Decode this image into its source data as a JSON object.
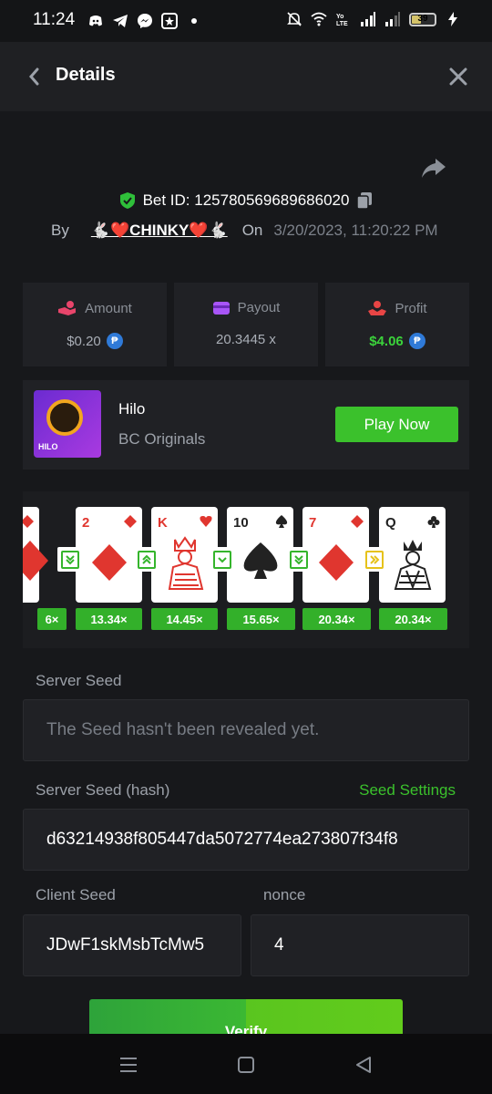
{
  "status_bar": {
    "time": "11:24",
    "battery": "39"
  },
  "header": {
    "title": "Details"
  },
  "bet": {
    "id_label": "Bet ID: 125780569689686020",
    "by_label": "By",
    "user": "🐇❤️CHINKY❤️🐇",
    "on_label": "On",
    "date": "3/20/2023, 11:20:22 PM"
  },
  "stats": [
    {
      "label": "Amount",
      "value": "$0.20",
      "coin": "₱",
      "icon": "hand-coin-icon"
    },
    {
      "label": "Payout",
      "value": "20.3445 x",
      "icon": "card-icon"
    },
    {
      "label": "Profit",
      "value": "$4.06",
      "coin": "₱",
      "icon": "profit-icon"
    }
  ],
  "game": {
    "thumb_tag": "HILO",
    "name": "Hilo",
    "provider": "BC Originals",
    "play_label": "Play Now"
  },
  "cards": [
    {
      "rank": "",
      "suit": "diamond",
      "color": "#e0362f"
    },
    {
      "rank": "2",
      "suit": "diamond",
      "color": "#e0362f"
    },
    {
      "rank": "K",
      "suit": "heart",
      "color": "#e0362f"
    },
    {
      "rank": "10",
      "suit": "spade",
      "color": "#222222"
    },
    {
      "rank": "7",
      "suit": "diamond",
      "color": "#e0362f"
    },
    {
      "rank": "Q",
      "suit": "club",
      "color": "#222222"
    }
  ],
  "multipliers": [
    "6×",
    "13.34×",
    "14.45×",
    "15.65×",
    "20.34×",
    "20.34×"
  ],
  "seeds": {
    "server_seed_label": "Server Seed",
    "server_seed_value": "The Seed hasn't been revealed yet.",
    "server_hash_label": "Server Seed (hash)",
    "seed_settings_label": "Seed Settings",
    "server_hash_value": "d63214938f805447da5072774ea273807f34f8",
    "client_seed_label": "Client Seed",
    "client_seed_value": "JDwF1skMsbTcMw5",
    "nonce_label": "nonce",
    "nonce_value": "4"
  },
  "verify_label": "Verify",
  "colors": {
    "accent_green": "#3bc12c",
    "background": "#17181b",
    "panel": "#202125"
  }
}
